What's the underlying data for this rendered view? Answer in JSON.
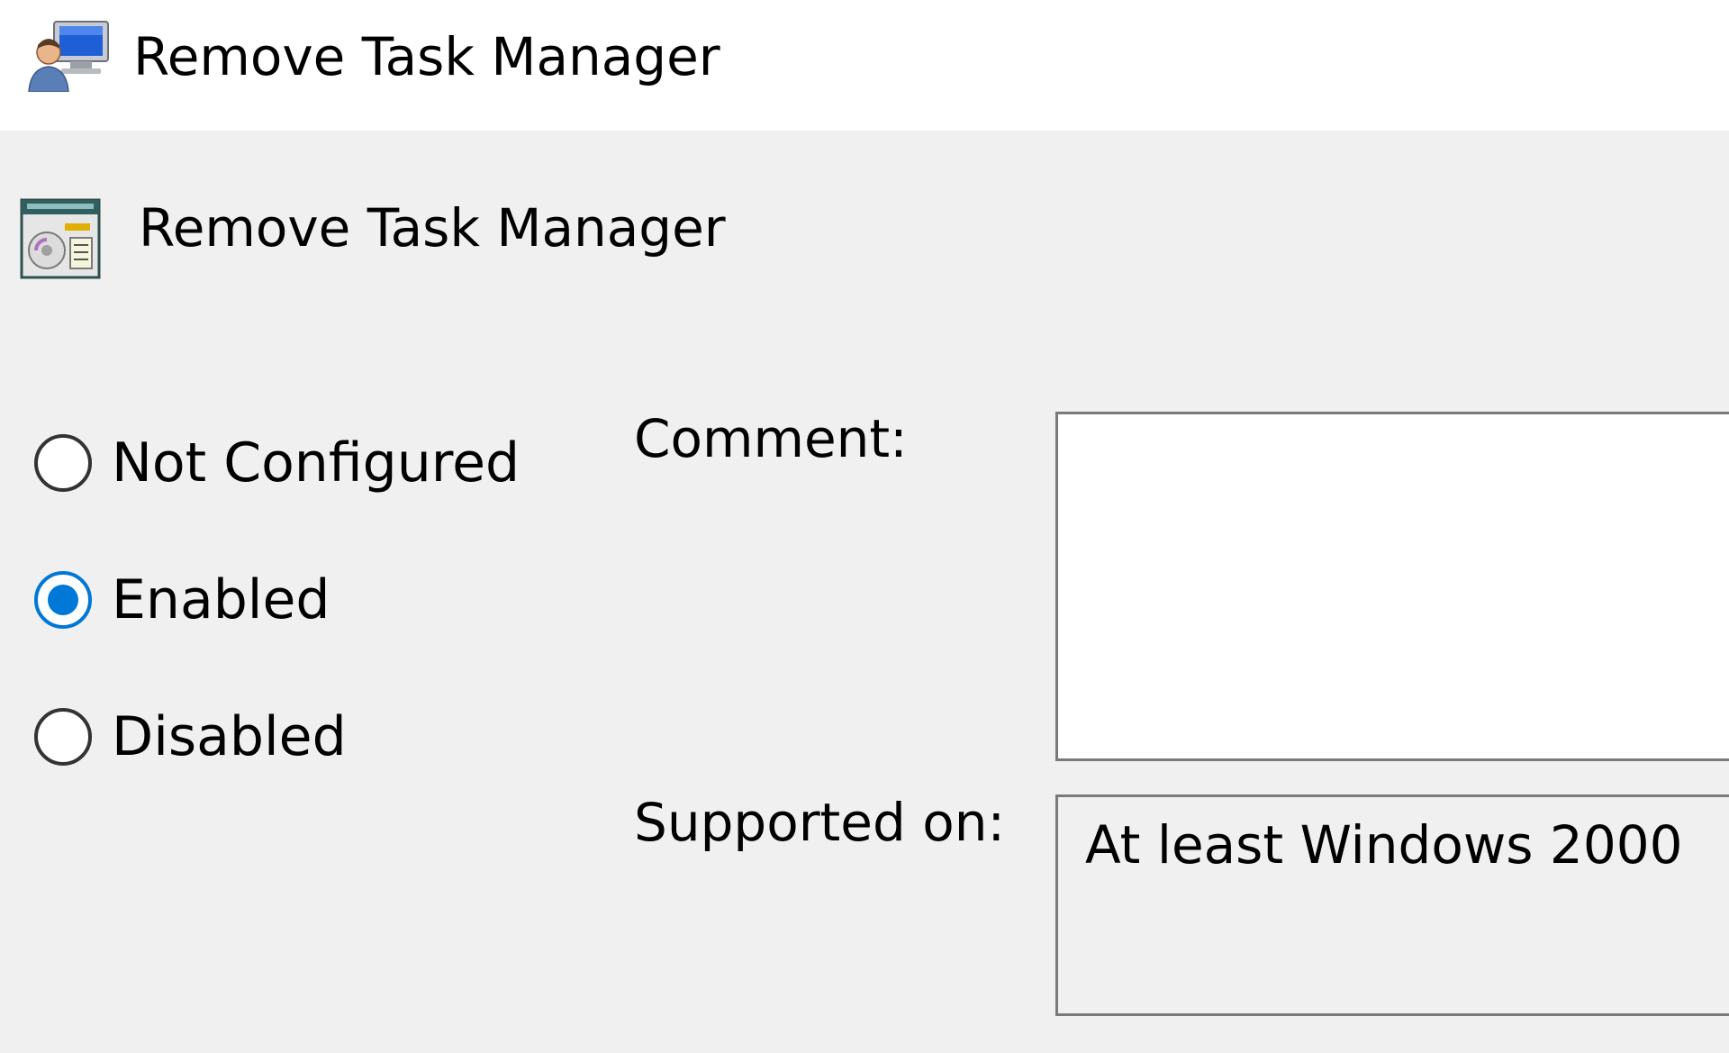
{
  "window": {
    "title": "Remove Task Manager",
    "icon": "group-policy-user-icon"
  },
  "policy": {
    "name": "Remove Task Manager",
    "icon": "policy-setting-icon"
  },
  "state": {
    "options": [
      {
        "label": "Not Configured",
        "selected": false
      },
      {
        "label": "Enabled",
        "selected": true
      },
      {
        "label": "Disabled",
        "selected": false
      }
    ]
  },
  "comment": {
    "label": "Comment:",
    "value": ""
  },
  "supported": {
    "label": "Supported on:",
    "value": "At least Windows 2000"
  },
  "colors": {
    "accent": "#0078d7",
    "dialog_background": "#f0f0f0",
    "titlebar_background": "#ffffff",
    "border": "#7a7a7a"
  }
}
